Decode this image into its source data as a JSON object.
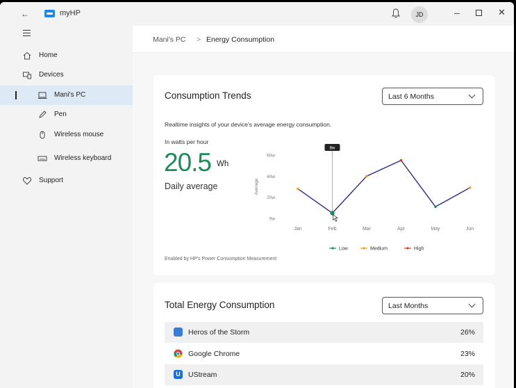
{
  "app": {
    "title": "myHP",
    "avatar_initials": "JD"
  },
  "sidebar": {
    "items": [
      {
        "label": "Home",
        "icon": "home-icon"
      },
      {
        "label": "Devices",
        "icon": "devices-icon"
      },
      {
        "label": "Mani's PC",
        "icon": "laptop-icon",
        "active": true
      },
      {
        "label": "Pen",
        "icon": "pen-icon"
      },
      {
        "label": "Wireless mouse",
        "icon": "mouse-icon"
      },
      {
        "label": "Wireless keyboard",
        "icon": "keyboard-icon"
      },
      {
        "label": "Support",
        "icon": "heart-support-icon"
      }
    ]
  },
  "breadcrumb": {
    "parent": "Mani's PC",
    "separator": ">",
    "current": "Energy Consumption"
  },
  "trends": {
    "title": "Consumption Trends",
    "range_value": "Last 6 Months",
    "insight": "Realtime insights of your device's average energy consumption.",
    "units_label": "In watts per hour",
    "big_value": "20.5",
    "big_unit": "Wh",
    "big_caption": "Daily average",
    "footnote": "Enabled by HP's Power Consumption Measurement"
  },
  "chart_data": {
    "type": "line",
    "x": [
      "Jan",
      "Feb",
      "Mar",
      "Apr",
      "May",
      "Jun"
    ],
    "values": [
      28,
      5,
      40,
      55,
      11,
      29
    ],
    "point_levels": [
      "Medium",
      "Low",
      "Medium",
      "High",
      "Low",
      "Medium"
    ],
    "ylabel": "Average",
    "yticks": [
      "0w",
      "20w",
      "40w",
      "60w"
    ],
    "ylim": [
      0,
      60
    ],
    "tooltip": {
      "index": 1,
      "label": "8w"
    },
    "legend": [
      {
        "name": "Low",
        "color": "#1e8c5a"
      },
      {
        "name": "Medium",
        "color": "#f39c12"
      },
      {
        "name": "High",
        "color": "#d63a1f"
      }
    ],
    "line_color": "#2d2a8c",
    "legend_position": "bottom-center"
  },
  "total": {
    "title": "Total Energy Consumption",
    "range_value": "Last Months",
    "rows": [
      {
        "name": "Heros of the Storm",
        "percent": "26%",
        "icon": "heroes-of-the-storm-icon",
        "color": "#3a7bd5"
      },
      {
        "name": "Google Chrome",
        "percent": "23%",
        "icon": "chrome-icon",
        "color": "#e0a21a"
      },
      {
        "name": "UStream",
        "percent": "20%",
        "icon": "ustream-icon",
        "color": "#1a6fd8"
      }
    ]
  }
}
